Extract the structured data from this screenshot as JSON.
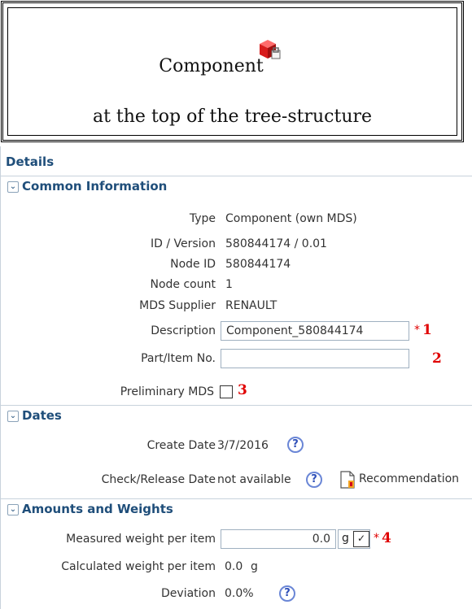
{
  "header": {
    "title": "Component",
    "subtitle": "at the top of the tree-structure",
    "icon": "component-cube-icon"
  },
  "details": {
    "title": "Details",
    "common": {
      "section_label": "Common Information",
      "type_label": "Type",
      "type_value": "Component (own MDS)",
      "id_label": "ID / Version",
      "id_value": "580844174 / 0.01",
      "node_id_label": "Node ID",
      "node_id_value": "580844174",
      "node_count_label": "Node count",
      "node_count_value": "1",
      "supplier_label": "MDS Supplier",
      "supplier_value": "RENAULT",
      "description_label": "Description",
      "description_value": "Component_580844174",
      "description_required": "*",
      "description_marker": "1",
      "part_label": "Part/Item No.",
      "part_value": "",
      "part_marker": "2",
      "preliminary_label": "Preliminary MDS",
      "preliminary_marker": "3"
    },
    "dates": {
      "section_label": "Dates",
      "create_label": "Create Date",
      "create_value": "3/7/2016",
      "check_label": "Check/Release Date",
      "check_value": "not available",
      "recommendation_label": "Recommendation"
    },
    "amounts": {
      "section_label": "Amounts and Weights",
      "measured_label": "Measured weight per item",
      "measured_value": "0.0",
      "unit": "g",
      "measured_required": "*",
      "measured_marker": "4",
      "calculated_label": "Calculated weight per item",
      "calculated_value": "0.0",
      "calculated_unit": "g",
      "deviation_label": "Deviation",
      "deviation_value": "0.0%"
    }
  },
  "colors": {
    "section_title": "#1f4e7a",
    "marker_red": "#e00000",
    "help_blue": "#2f4fb8"
  }
}
